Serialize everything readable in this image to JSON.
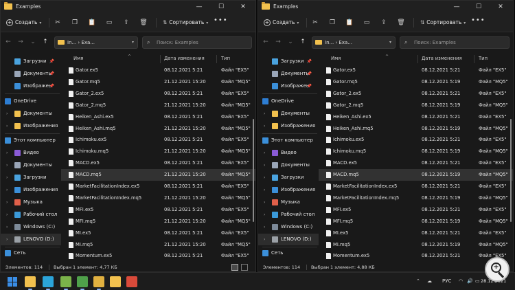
{
  "windows": [
    {
      "title": "Examples",
      "toolbar": {
        "new_label": "Создать",
        "sort_label": "Сортировать"
      },
      "path_text": "In... › Exa...",
      "search_placeholder": "Поиск: Examples",
      "columns": {
        "name": "Имя",
        "date": "Дата изменения",
        "type": "Тип"
      },
      "sidebar": [
        {
          "label": "Загрузки",
          "icon": "download-icon",
          "color": "#4aa3df",
          "pin": true
        },
        {
          "label": "Документы",
          "icon": "documents-icon",
          "color": "#9aa6b8",
          "pin": true
        },
        {
          "label": "Изображен",
          "icon": "pictures-icon",
          "color": "#3b8fd9",
          "pin": true
        },
        {
          "label": "OneDrive",
          "icon": "cloud-icon",
          "color": "#2d7dd2",
          "expand": true
        },
        {
          "label": "Документы",
          "icon": "folder-icon",
          "color": "#f2c14e",
          "expand": true
        },
        {
          "label": "Изображения",
          "icon": "folder-icon",
          "color": "#f2c14e",
          "expand": true
        },
        {
          "label": "Этот компьютер",
          "icon": "computer-icon",
          "color": "#3b8fd9",
          "expand": true
        },
        {
          "label": "Видео",
          "icon": "video-icon",
          "color": "#8a5bd6",
          "expand": true
        },
        {
          "label": "Документы",
          "icon": "documents-icon",
          "color": "#9aa6b8",
          "expand": true
        },
        {
          "label": "Загрузки",
          "icon": "download-icon",
          "color": "#4aa3df",
          "expand": true
        },
        {
          "label": "Изображения",
          "icon": "pictures-icon",
          "color": "#3b8fd9",
          "expand": true
        },
        {
          "label": "Музыка",
          "icon": "music-icon",
          "color": "#e0604a",
          "expand": true
        },
        {
          "label": "Рабочий стол",
          "icon": "desktop-icon",
          "color": "#3b9ad9",
          "expand": true
        },
        {
          "label": "Windows (C:)",
          "icon": "drive-icon",
          "color": "#7d8a99",
          "expand": true
        },
        {
          "label": "LENOVO (D:)",
          "icon": "drive-icon",
          "color": "#9aa0a6",
          "expand": true,
          "selected": true
        },
        {
          "label": "Сеть",
          "icon": "network-icon",
          "color": "#3b8fd9",
          "expand": true
        }
      ],
      "files": [
        {
          "name": "Gator.ex5",
          "date": "08.12.2021 5:21",
          "type": "Файл \"EX5\""
        },
        {
          "name": "Gator.mq5",
          "date": "21.12.2021 15:20",
          "type": "Файл \"MQ5\""
        },
        {
          "name": "Gator_2.ex5",
          "date": "08.12.2021 5:21",
          "type": "Файл \"EX5\""
        },
        {
          "name": "Gator_2.mq5",
          "date": "21.12.2021 15:20",
          "type": "Файл \"MQ5\""
        },
        {
          "name": "Heiken_Ashi.ex5",
          "date": "08.12.2021 5:21",
          "type": "Файл \"EX5\""
        },
        {
          "name": "Heiken_Ashi.mq5",
          "date": "21.12.2021 15:20",
          "type": "Файл \"MQ5\""
        },
        {
          "name": "Ichimoku.ex5",
          "date": "08.12.2021 5:21",
          "type": "Файл \"EX5\""
        },
        {
          "name": "Ichimoku.mq5",
          "date": "21.12.2021 15:20",
          "type": "Файл \"MQ5\""
        },
        {
          "name": "MACD.ex5",
          "date": "08.12.2021 5:21",
          "type": "Файл \"EX5\""
        },
        {
          "name": "MACD.mq5",
          "date": "21.12.2021 15:20",
          "type": "Файл \"MQ5\"",
          "selected": true
        },
        {
          "name": "MarketFacilitationIndex.ex5",
          "date": "08.12.2021 5:21",
          "type": "Файл \"EX5\""
        },
        {
          "name": "MarketFacilitationIndex.mq5",
          "date": "21.12.2021 15:20",
          "type": "Файл \"MQ5\""
        },
        {
          "name": "MFI.ex5",
          "date": "08.12.2021 5:21",
          "type": "Файл \"EX5\""
        },
        {
          "name": "MFI.mq5",
          "date": "21.12.2021 15:20",
          "type": "Файл \"MQ5\""
        },
        {
          "name": "MI.ex5",
          "date": "08.12.2021 5:21",
          "type": "Файл \"EX5\""
        },
        {
          "name": "MI.mq5",
          "date": "21.12.2021 15:20",
          "type": "Файл \"MQ5\""
        },
        {
          "name": "Momentum.ex5",
          "date": "08.12.2021 5:21",
          "type": "Файл \"EX5\""
        }
      ],
      "status": {
        "count": "Элементов: 114",
        "selection": "Выбран 1 элемент: 4,77 КБ"
      }
    },
    {
      "title": "Examples",
      "toolbar": {
        "new_label": "Создать",
        "sort_label": "Сортировать"
      },
      "path_text": "In... › Exa...",
      "search_placeholder": "Поиск: Examples",
      "columns": {
        "name": "Имя",
        "date": "Дата изменения",
        "type": "Тип"
      },
      "sidebar": [
        {
          "label": "Загрузки",
          "icon": "download-icon",
          "color": "#4aa3df",
          "pin": true
        },
        {
          "label": "Документы",
          "icon": "documents-icon",
          "color": "#9aa6b8",
          "pin": true
        },
        {
          "label": "Изображен",
          "icon": "pictures-icon",
          "color": "#3b8fd9",
          "pin": true
        },
        {
          "label": "OneDrive",
          "icon": "cloud-icon",
          "color": "#2d7dd2",
          "expand": true
        },
        {
          "label": "Документы",
          "icon": "folder-icon",
          "color": "#f2c14e",
          "expand": true
        },
        {
          "label": "Изображения",
          "icon": "folder-icon",
          "color": "#f2c14e",
          "expand": true
        },
        {
          "label": "Этот компьютер",
          "icon": "computer-icon",
          "color": "#3b8fd9",
          "expand": true
        },
        {
          "label": "Видео",
          "icon": "video-icon",
          "color": "#8a5bd6",
          "expand": true
        },
        {
          "label": "Документы",
          "icon": "documents-icon",
          "color": "#9aa6b8",
          "expand": true
        },
        {
          "label": "Загрузки",
          "icon": "download-icon",
          "color": "#4aa3df",
          "expand": true
        },
        {
          "label": "Изображения",
          "icon": "pictures-icon",
          "color": "#3b8fd9",
          "expand": true
        },
        {
          "label": "Музыка",
          "icon": "music-icon",
          "color": "#e0604a",
          "expand": true
        },
        {
          "label": "Рабочий стол",
          "icon": "desktop-icon",
          "color": "#3b9ad9",
          "expand": true
        },
        {
          "label": "Windows (C:)",
          "icon": "drive-icon",
          "color": "#7d8a99",
          "expand": true
        },
        {
          "label": "LENOVO (D:)",
          "icon": "drive-icon",
          "color": "#9aa0a6",
          "expand": true,
          "selected": true
        },
        {
          "label": "Сеть",
          "icon": "network-icon",
          "color": "#3b8fd9",
          "expand": true
        }
      ],
      "files": [
        {
          "name": "Gator.ex5",
          "date": "08.12.2021 5:21",
          "type": "Файл \"EX5\""
        },
        {
          "name": "Gator.mq5",
          "date": "08.12.2021 5:19",
          "type": "Файл \"MQ5\""
        },
        {
          "name": "Gator_2.ex5",
          "date": "08.12.2021 5:21",
          "type": "Файл \"EX5\""
        },
        {
          "name": "Gator_2.mq5",
          "date": "08.12.2021 5:19",
          "type": "Файл \"MQ5\""
        },
        {
          "name": "Heiken_Ashi.ex5",
          "date": "08.12.2021 5:21",
          "type": "Файл \"EX5\""
        },
        {
          "name": "Heiken_Ashi.mq5",
          "date": "08.12.2021 5:19",
          "type": "Файл \"MQ5\""
        },
        {
          "name": "Ichimoku.ex5",
          "date": "08.12.2021 5:21",
          "type": "Файл \"EX5\""
        },
        {
          "name": "Ichimoku.mq5",
          "date": "08.12.2021 5:19",
          "type": "Файл \"MQ5\""
        },
        {
          "name": "MACD.ex5",
          "date": "08.12.2021 5:21",
          "type": "Файл \"EX5\""
        },
        {
          "name": "MACD.mq5",
          "date": "08.12.2021 5:19",
          "type": "Файл \"MQ5\"",
          "selected": true
        },
        {
          "name": "MarketFacilitationIndex.ex5",
          "date": "08.12.2021 5:21",
          "type": "Файл \"EX5\""
        },
        {
          "name": "MarketFacilitationIndex.mq5",
          "date": "08.12.2021 5:19",
          "type": "Файл \"MQ5\""
        },
        {
          "name": "MFI.ex5",
          "date": "08.12.2021 5:21",
          "type": "Файл \"EX5\""
        },
        {
          "name": "MFI.mq5",
          "date": "08.12.2021 5:19",
          "type": "Файл \"MQ5\""
        },
        {
          "name": "MI.ex5",
          "date": "08.12.2021 5:21",
          "type": "Файл \"EX5\""
        },
        {
          "name": "MI.mq5",
          "date": "08.12.2021 5:19",
          "type": "Файл \"MQ5\""
        },
        {
          "name": "Momentum.ex5",
          "date": "08.12.2021 5:21",
          "type": "Файл \"EX5\""
        }
      ],
      "status": {
        "count": "Элементов: 114",
        "selection": "Выбран 1 элемент: 4,88 КБ"
      }
    }
  ],
  "taskbar": {
    "apps": [
      {
        "icon": "windows-start-icon",
        "color": "#3a8ee6"
      },
      {
        "icon": "file-explorer-icon",
        "color": "#f2c14e"
      },
      {
        "icon": "edge-browser-icon",
        "color": "#2ba4d9"
      },
      {
        "icon": "metatrader-icon",
        "color": "#7bb34a"
      },
      {
        "icon": "metatrader-icon",
        "color": "#4fa04a"
      },
      {
        "icon": "metaeditor-icon",
        "color": "#e0b040"
      },
      {
        "icon": "file-explorer-icon",
        "color": "#f2c14e"
      },
      {
        "icon": "snipping-tool-icon",
        "color": "#d94a3a"
      }
    ],
    "language": "РУС",
    "date": "28.12.2021"
  }
}
